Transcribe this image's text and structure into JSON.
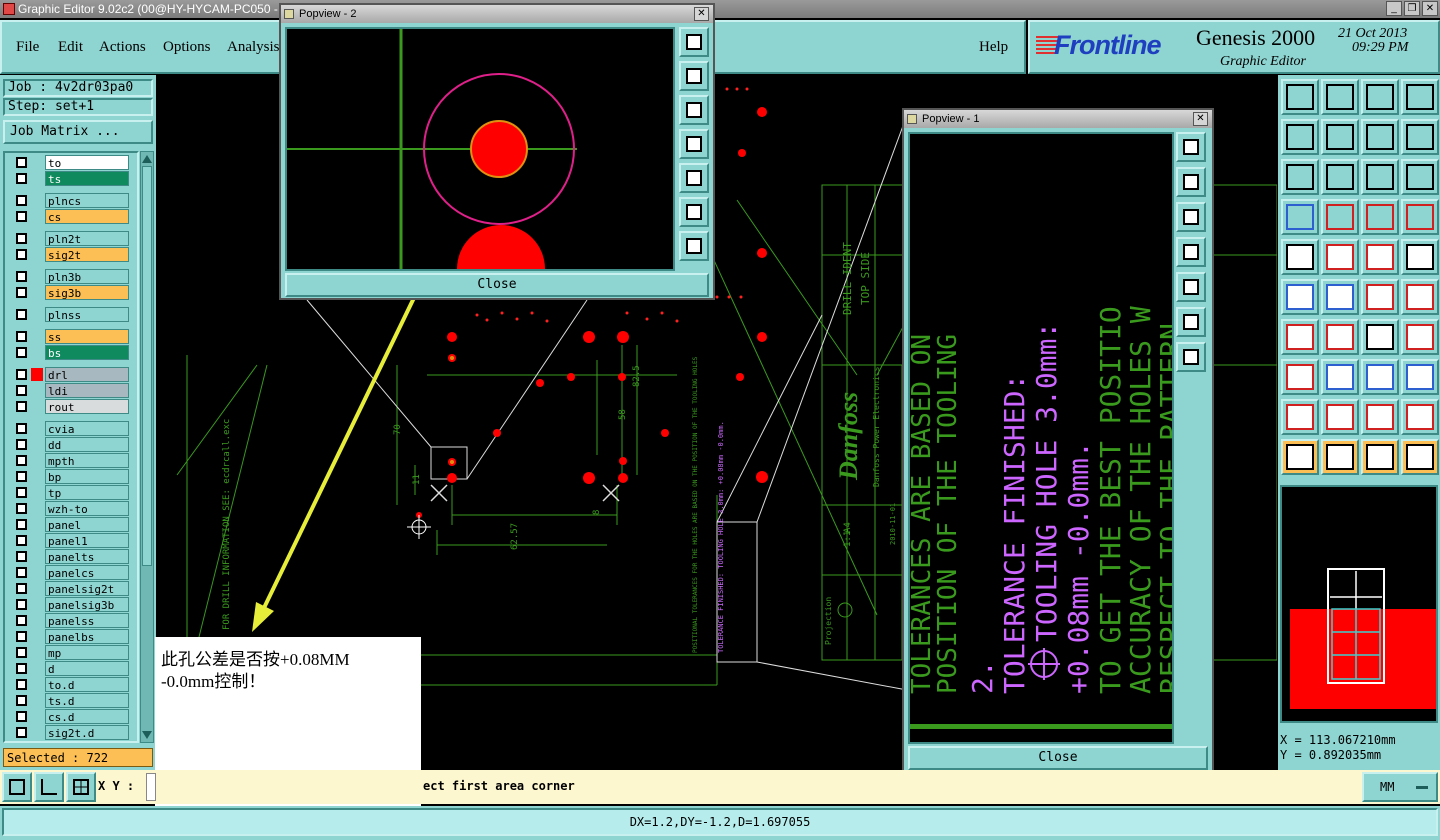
{
  "window": {
    "title": "Graphic Editor 9.02c2 (00@HY-HYCAM-PC050 -"
  },
  "menu": {
    "file": "File",
    "edit": "Edit",
    "actions": "Actions",
    "options": "Options",
    "analysis": "Analysis",
    "help": "Help"
  },
  "brand": {
    "logo": "Frontline",
    "product": "Genesis 2000",
    "subtitle": "Graphic Editor",
    "date": "21 Oct 2013",
    "time": "09:29 PM"
  },
  "job": {
    "job_label": "Job : 4v2dr03pa0",
    "step_label": "Step: set+1",
    "matrix_button": "Job Matrix ..."
  },
  "layers": [
    {
      "name": "to",
      "color": "#ffffff"
    },
    {
      "name": "ts",
      "color": "#0e8a5e"
    },
    {
      "name": "plncs",
      "color": "#8ed4d0"
    },
    {
      "name": "cs",
      "color": "#fbbf55"
    },
    {
      "name": "pln2t",
      "color": "#8ed4d0"
    },
    {
      "name": "sig2t",
      "color": "#fbbf55"
    },
    {
      "name": "pln3b",
      "color": "#8ed4d0"
    },
    {
      "name": "sig3b",
      "color": "#fbbf55"
    },
    {
      "name": "plnss",
      "color": "#8ed4d0"
    },
    {
      "name": "ss",
      "color": "#fbbf55"
    },
    {
      "name": "bs",
      "color": "#0e8a5e"
    },
    {
      "name": "drl",
      "color": "#a8b8c0"
    },
    {
      "name": "ldi",
      "color": "#a8b8c0"
    },
    {
      "name": "rout",
      "color": "#d8dcdc"
    },
    {
      "name": "cvia",
      "color": "#8ed4d0"
    },
    {
      "name": "dd",
      "color": "#8ed4d0"
    },
    {
      "name": "mpth",
      "color": "#8ed4d0"
    },
    {
      "name": "bp",
      "color": "#8ed4d0"
    },
    {
      "name": "tp",
      "color": "#8ed4d0"
    },
    {
      "name": "wzh-to",
      "color": "#8ed4d0"
    },
    {
      "name": "panel",
      "color": "#8ed4d0"
    },
    {
      "name": "panel1",
      "color": "#8ed4d0"
    },
    {
      "name": "panelts",
      "color": "#8ed4d0"
    },
    {
      "name": "panelcs",
      "color": "#8ed4d0"
    },
    {
      "name": "panelsig2t",
      "color": "#8ed4d0"
    },
    {
      "name": "panelsig3b",
      "color": "#8ed4d0"
    },
    {
      "name": "panelss",
      "color": "#8ed4d0"
    },
    {
      "name": "panelbs",
      "color": "#8ed4d0"
    },
    {
      "name": "mp",
      "color": "#8ed4d0"
    },
    {
      "name": "d",
      "color": "#8ed4d0"
    },
    {
      "name": "to.d",
      "color": "#8ed4d0"
    },
    {
      "name": "ts.d",
      "color": "#8ed4d0"
    },
    {
      "name": "cs.d",
      "color": "#8ed4d0"
    },
    {
      "name": "sig2t.d",
      "color": "#8ed4d0"
    }
  ],
  "selected": "Selected : 722",
  "popview2": {
    "title": "Popview - 2",
    "close": "Close"
  },
  "popview1": {
    "title": "Popview - 1",
    "close": "Close",
    "lines": [
      "TOLERANCES ARE BASED ON",
      "POSITION OF THE TOOLING",
      "2.",
      "TOLERANCE FINISHED:",
      "TOOLING HOLE 3.0mm:",
      "+0.08mm -0.0mm.",
      "TO GET THE BEST POSITIO",
      "ACCURACY OF THE HOLES W",
      "RESPECT TO THE PATTERN,"
    ]
  },
  "canvas_text": {
    "drill_ident": "DRILL IDENT",
    "top_side": "TOP SIDE",
    "drill_info": "FOR DRILL INFORMATION SEE: ecdrcall.exc",
    "dim_1": "82.5",
    "dim_2": "58",
    "dim_3": "62.57",
    "dim_4": "70",
    "dim_5": "11",
    "dim_6": "8",
    "company": "Danfoss Power Electronics",
    "logo": "Danfoss",
    "scale": "1:1",
    "paper": "A4",
    "projection": "Projection",
    "date_small": "2010-11-01",
    "notes_small": "POSITIONAL TOLERANCES FOR THE HOLES ARE BASED ON THE POSITION OF THE TOOLING HOLES",
    "notes_small_2": "TOLERANCE FINISHED: TOOLING HOLE 3.0mm: +0.08mm -0.0mm."
  },
  "annotation": {
    "line1": "此孔公差是否按+0.08MM",
    "line2": "-0.0mm控制！"
  },
  "coords": {
    "x": "X = 113.067210mm",
    "y": "Y = 0.892035mm"
  },
  "status": {
    "xy_label": "X Y :",
    "prompt": "ect first area corner",
    "units": "MM"
  },
  "measure": "DX=1.2,DY=-1.2,D=1.697055",
  "colors": {
    "panel": "#8ed4d0",
    "canvas": "#000000",
    "drill": "#ff0000",
    "profile": "#3a9a1e",
    "text_layer": "#cc66ff",
    "status": "#fdf7cf",
    "selected_bg": "#fbbf55"
  },
  "icons": [
    "zoom-area-icon",
    "zoom-in-icon",
    "zoom-out-icon",
    "pan-left-icon",
    "pan-right-icon",
    "fit-icon",
    "home-icon",
    "grid-icon",
    "help-icon",
    "select-icon",
    "measure-icon",
    "snap-icon"
  ]
}
